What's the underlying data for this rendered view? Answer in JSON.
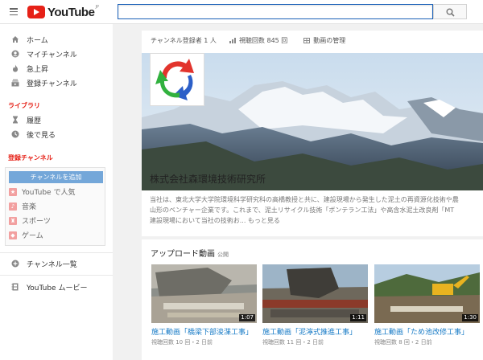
{
  "header": {
    "logo_text": "YouTube",
    "logo_region": "JP",
    "search": {
      "value": "",
      "placeholder": ""
    }
  },
  "sidebar": {
    "main_items": [
      {
        "label": "ホーム",
        "icon": "home-icon"
      },
      {
        "label": "マイチャンネル",
        "icon": "person-icon"
      },
      {
        "label": "急上昇",
        "icon": "flame-icon"
      },
      {
        "label": "登録チャンネル",
        "icon": "subscriptions-icon"
      }
    ],
    "library_title": "ライブラリ",
    "library_items": [
      {
        "label": "履歴",
        "icon": "hourglass-icon"
      },
      {
        "label": "後で見る",
        "icon": "clock-icon"
      }
    ],
    "subscriptions_title": "登録チャンネル",
    "add_channel_label": "チャンネルを追加",
    "subscription_items": [
      {
        "label": "YouTube で人気",
        "icon": "star-icon"
      },
      {
        "label": "音楽",
        "icon": "music-icon"
      },
      {
        "label": "スポーツ",
        "icon": "trophy-icon"
      },
      {
        "label": "ゲーム",
        "icon": "gamepad-icon"
      }
    ],
    "channel_list_label": "チャンネル一覧",
    "movies_label": "YouTube ムービー"
  },
  "channel": {
    "stats": {
      "subscribers": "チャンネル登録者 1 人",
      "views": "視聴回数 845 回",
      "manage": "動画の管理"
    },
    "name": "株式会社森環境技術研究所",
    "description_line1": "当社は、東北大学大学院環境科学研究科の高橋教授と共に、建設現場から発生した泥土の再資源化技術や農",
    "description_line2": "山形のベンチャー企業です。これまで、泥土リサイクル技術「ボンテラン工法」や高含水泥土改良剤「MT",
    "description_line3": "建設現場において当社の技術お... もっと見る"
  },
  "uploads": {
    "title": "アップロード動画",
    "visibility": "公開",
    "videos": [
      {
        "title": "施工動画「橋梁下部浚渫工事」",
        "meta": "視聴回数 10 回・2 日前",
        "duration": "1:07"
      },
      {
        "title": "施工動画「泥濘式推進工事」",
        "meta": "視聴回数 11 回・2 日前",
        "duration": "1:11"
      },
      {
        "title": "施工動画「ため池改修工事」",
        "meta": "視聴回数 8 回・2 日前",
        "duration": "1:30"
      }
    ]
  },
  "colors": {
    "youtube_red": "#e62117",
    "link_blue": "#167ac6",
    "subscribe_blue": "#74a7d9",
    "search_border": "#1c62b9"
  }
}
